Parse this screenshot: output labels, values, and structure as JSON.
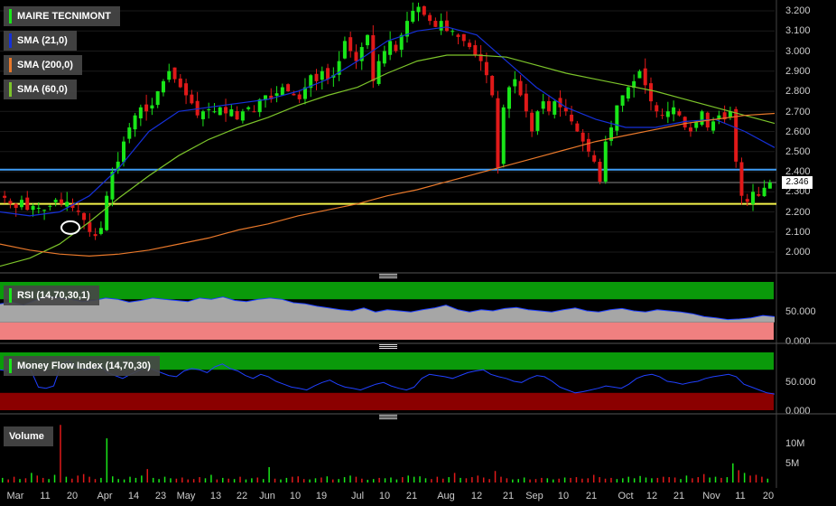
{
  "legend": {
    "main": "MAIRE TECNIMONT",
    "sma21": "SMA (21,0)",
    "sma200": "SMA (200,0)",
    "sma60": "SMA (60,0)",
    "rsi": "RSI (14,70,30,1)",
    "mfi": "Money Flow Index (14,70,30)",
    "volume": "Volume"
  },
  "colors": {
    "up": "#19e619",
    "down": "#e01919",
    "sma21": "#1530d8",
    "sma200": "#e8782a",
    "sma60": "#7cc42a",
    "hline_blue": "#3f9df5",
    "hline_yellow": "#f4f24a",
    "zone_green": "#0a9a0a",
    "zone_red": "#f08080",
    "zone_darkred": "#8b0000"
  },
  "last_price_label": "2.346",
  "chart_data": [
    {
      "type": "candlestick",
      "title": "MAIRE TECNIMONT",
      "ylim": [
        1.9,
        3.25
      ],
      "ytick_labels": [
        "2.000",
        "2.100",
        "2.200",
        "2.300",
        "2.400",
        "2.500",
        "2.600",
        "2.700",
        "2.800",
        "2.900",
        "3.000",
        "3.100",
        "3.200"
      ],
      "xtick_labels": [
        "Mar",
        "11",
        "20",
        "Apr",
        "14",
        "23",
        "May",
        "13",
        "22",
        "Jun",
        "10",
        "19",
        "Jul",
        "10",
        "21",
        "Aug",
        "12",
        "21",
        "Sep",
        "10",
        "21",
        "Oct",
        "12",
        "21",
        "Nov",
        "11",
        "20"
      ],
      "close_anchors": [
        2.27,
        2.24,
        2.22,
        2.26,
        2.21,
        2.23,
        2.22,
        2.21,
        2.23,
        2.26,
        2.24,
        2.25,
        2.22,
        2.2,
        2.16,
        2.1,
        2.08,
        2.12,
        2.28,
        2.4,
        2.45,
        2.55,
        2.62,
        2.68,
        2.72,
        2.7,
        2.73,
        2.8,
        2.85,
        2.9,
        2.86,
        2.82,
        2.78,
        2.74,
        2.68,
        2.7,
        2.71,
        2.7,
        2.72,
        2.69,
        2.71,
        2.66,
        2.7,
        2.72,
        2.7,
        2.76,
        2.78,
        2.76,
        2.79,
        2.82,
        2.8,
        2.78,
        2.76,
        2.82,
        2.88,
        2.85,
        2.9,
        2.86,
        2.88,
        2.95,
        3.05,
        3.0,
        2.95,
        3.02,
        3.08,
        2.85,
        2.95,
        3.0,
        3.05,
        3.0,
        3.08,
        3.15,
        3.2,
        3.22,
        3.18,
        3.15,
        3.12,
        3.15,
        3.1,
        3.1,
        3.07,
        3.05,
        3.02,
        2.98,
        2.95,
        2.88,
        2.78,
        2.42,
        2.72,
        2.82,
        2.86,
        2.78,
        2.7,
        2.6,
        2.7,
        2.75,
        2.7,
        2.75,
        2.72,
        2.7,
        2.65,
        2.6,
        2.55,
        2.5,
        2.45,
        2.35,
        2.55,
        2.62,
        2.73,
        2.78,
        2.82,
        2.85,
        2.9,
        2.83,
        2.75,
        2.7,
        2.68,
        2.7,
        2.72,
        2.68,
        2.62,
        2.6,
        2.65,
        2.7,
        2.62,
        2.65,
        2.68,
        2.66,
        2.7,
        2.45,
        2.28,
        2.25,
        2.3,
        2.28,
        2.32,
        2.346
      ],
      "series": [
        {
          "name": "SMA (21,0)",
          "values": [
            2.2,
            2.18,
            2.2,
            2.28,
            2.42,
            2.6,
            2.7,
            2.72,
            2.74,
            2.76,
            2.8,
            2.86,
            2.95,
            3.05,
            3.1,
            3.12,
            3.08,
            2.95,
            2.82,
            2.72,
            2.66,
            2.62,
            2.62,
            2.65,
            2.66,
            2.6,
            2.52
          ]
        },
        {
          "name": "SMA (60,0)",
          "values": [
            1.93,
            1.97,
            2.04,
            2.15,
            2.27,
            2.38,
            2.48,
            2.56,
            2.62,
            2.67,
            2.73,
            2.78,
            2.82,
            2.89,
            2.95,
            2.98,
            2.98,
            2.97,
            2.93,
            2.89,
            2.86,
            2.83,
            2.8,
            2.76,
            2.72,
            2.68,
            2.64
          ]
        },
        {
          "name": "SMA (200,0)",
          "values": [
            2.04,
            2.01,
            1.99,
            1.98,
            1.99,
            2.01,
            2.04,
            2.07,
            2.11,
            2.14,
            2.18,
            2.21,
            2.24,
            2.28,
            2.31,
            2.35,
            2.39,
            2.43,
            2.47,
            2.51,
            2.55,
            2.58,
            2.61,
            2.64,
            2.66,
            2.68,
            2.69
          ]
        }
      ],
      "hlines": [
        2.41,
        2.24
      ]
    },
    {
      "type": "area",
      "title": "RSI (14,70,30,1)",
      "ylim": [
        0,
        100
      ],
      "ytick_labels": [
        "50.000",
        "0.000"
      ],
      "zones": [
        70,
        30
      ],
      "values": [
        62,
        65,
        60,
        68,
        75,
        72,
        70,
        66,
        68,
        72,
        70,
        65,
        68,
        72,
        70,
        68,
        66,
        72,
        70,
        74,
        68,
        66,
        70,
        72,
        70,
        64,
        62,
        58,
        55,
        52,
        50,
        55,
        48,
        52,
        50,
        48,
        52,
        55,
        60,
        52,
        48,
        52,
        50,
        54,
        56,
        52,
        50,
        48,
        52,
        55,
        50,
        48,
        52,
        54,
        50,
        48,
        52,
        50,
        48,
        45,
        40,
        38,
        35,
        36,
        38,
        42,
        40
      ]
    },
    {
      "type": "line",
      "title": "Money Flow Index (14,70,30)",
      "ylim": [
        0,
        100
      ],
      "ytick_labels": [
        "50.000",
        "0.000"
      ],
      "zones": [
        70,
        30
      ],
      "values": [
        70,
        68,
        72,
        75,
        70,
        40,
        38,
        42,
        80,
        85,
        75,
        70,
        72,
        78,
        65,
        60,
        55,
        62,
        68,
        75,
        70,
        65,
        60,
        58,
        68,
        72,
        70,
        65,
        75,
        80,
        72,
        68,
        60,
        55,
        62,
        58,
        50,
        45,
        40,
        38,
        35,
        42,
        48,
        52,
        45,
        40,
        38,
        35,
        40,
        45,
        48,
        42,
        38,
        35,
        40,
        55,
        62,
        60,
        58,
        55,
        60,
        65,
        68,
        70,
        62,
        58,
        55,
        50,
        48,
        55,
        60,
        58,
        50,
        40,
        35,
        30,
        32,
        35,
        38,
        42,
        40,
        38,
        45,
        55,
        60,
        62,
        58,
        50,
        48,
        45,
        48,
        50,
        55,
        58,
        60,
        62,
        58,
        45,
        40,
        35,
        30,
        28
      ]
    },
    {
      "type": "bar",
      "title": "Volume",
      "ytick_labels": [
        "10M",
        "5M"
      ],
      "values_millions": [
        1.2,
        0.8,
        1.5,
        0.9,
        1.1,
        2.5,
        1.8,
        1.2,
        0.9,
        2.0,
        15.0,
        1.5,
        1.0,
        1.8,
        2.2,
        1.5,
        0.9,
        1.2,
        11.5,
        1.6,
        0.9,
        0.8,
        1.5,
        1.2,
        1.8,
        3.5,
        1.2,
        0.9,
        1.5,
        1.1,
        1.0,
        1.3,
        0.8,
        0.9,
        1.4,
        1.1,
        2.0,
        0.8,
        1.2,
        1.0,
        0.9,
        1.5,
        0.8,
        1.1,
        1.3,
        0.9,
        4.0,
        1.0,
        0.8,
        1.2,
        1.5,
        1.6,
        0.9,
        0.8,
        1.1,
        1.3,
        1.6,
        0.8,
        0.9,
        1.4,
        1.8,
        1.5,
        1.0,
        0.7,
        0.9,
        1.2,
        1.1,
        1.3,
        0.8,
        1.4,
        1.8,
        1.5,
        1.6,
        1.1,
        0.9,
        1.5,
        1.0,
        1.4,
        2.5,
        1.2,
        1.1,
        1.4,
        1.8,
        1.3,
        0.9,
        3.0,
        1.5,
        1.1,
        0.8,
        0.9,
        1.3,
        0.8,
        0.9,
        1.2,
        1.1,
        0.8,
        1.0,
        1.3,
        1.2,
        1.4,
        1.0,
        1.1,
        2.0,
        1.4,
        1.0,
        1.2,
        0.9,
        1.1,
        1.5,
        1.1,
        1.7,
        1.3,
        1.1,
        1.2,
        1.5,
        1.4,
        1.3,
        0.9,
        1.8,
        1.1,
        1.4,
        2.2,
        1.3,
        1.5,
        1.2,
        1.4,
        5.0,
        3.2,
        2.5,
        1.8,
        2.0,
        1.5,
        1.0
      ]
    }
  ]
}
